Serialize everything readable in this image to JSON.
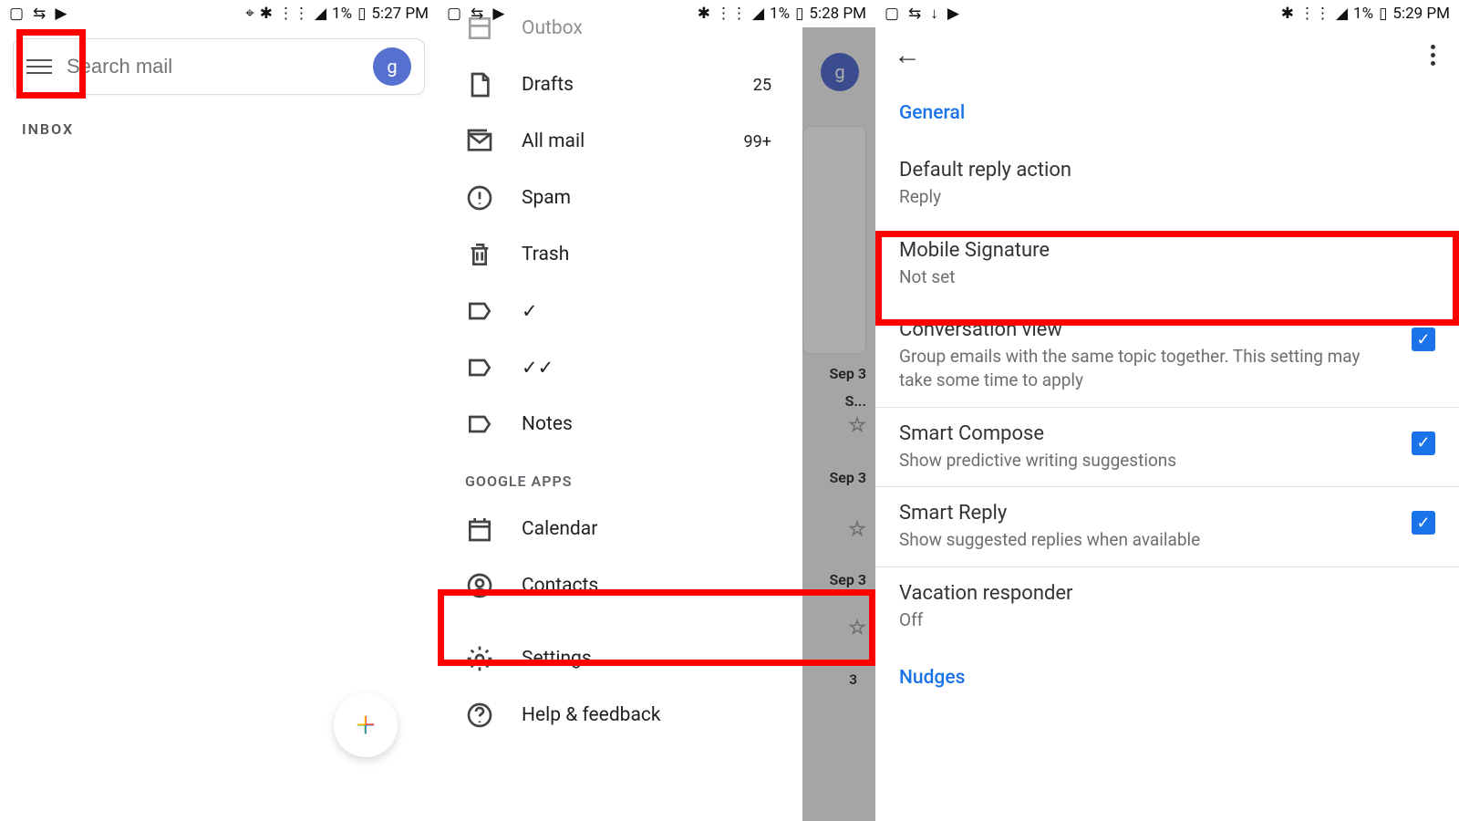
{
  "panel1": {
    "status": {
      "battery": "1%",
      "time": "5:27 PM"
    },
    "search_placeholder": "Search mail",
    "avatar_letter": "g",
    "inbox_label": "INBOX"
  },
  "panel2": {
    "status": {
      "battery": "1%",
      "time": "5:28 PM"
    },
    "drawer": {
      "items": [
        {
          "icon": "outbox",
          "label": "Outbox",
          "count": ""
        },
        {
          "icon": "drafts",
          "label": "Drafts",
          "count": "25"
        },
        {
          "icon": "allmail",
          "label": "All mail",
          "count": "99+"
        },
        {
          "icon": "spam",
          "label": "Spam",
          "count": ""
        },
        {
          "icon": "trash",
          "label": "Trash",
          "count": ""
        },
        {
          "icon": "label",
          "label": "✓",
          "count": ""
        },
        {
          "icon": "label",
          "label": "✓✓",
          "count": ""
        },
        {
          "icon": "label",
          "label": "Notes",
          "count": ""
        }
      ],
      "section": "GOOGLE APPS",
      "apps": [
        {
          "icon": "calendar",
          "label": "Calendar"
        },
        {
          "icon": "contacts",
          "label": "Contacts"
        }
      ],
      "bottom": [
        {
          "icon": "settings",
          "label": "Settings"
        },
        {
          "icon": "help",
          "label": "Help & feedback"
        }
      ]
    },
    "peek": {
      "dates": [
        "Sep 3",
        "Sep 3",
        "Sep 3"
      ],
      "truncated": "S..."
    }
  },
  "panel3": {
    "status": {
      "battery": "1%",
      "time": "5:29 PM"
    },
    "section": "General",
    "settings": [
      {
        "title": "Default reply action",
        "sub": "Reply",
        "chk": false
      },
      {
        "title": "Mobile Signature",
        "sub": "Not set",
        "chk": false
      },
      {
        "title": "Conversation view",
        "sub": "Group emails with the same topic together. This setting may take some time to apply",
        "chk": true
      },
      {
        "title": "Smart Compose",
        "sub": "Show predictive writing suggestions",
        "chk": true
      },
      {
        "title": "Smart Reply",
        "sub": "Show suggested replies when available",
        "chk": true
      },
      {
        "title": "Vacation responder",
        "sub": "Off",
        "chk": false
      }
    ],
    "section2": "Nudges"
  }
}
